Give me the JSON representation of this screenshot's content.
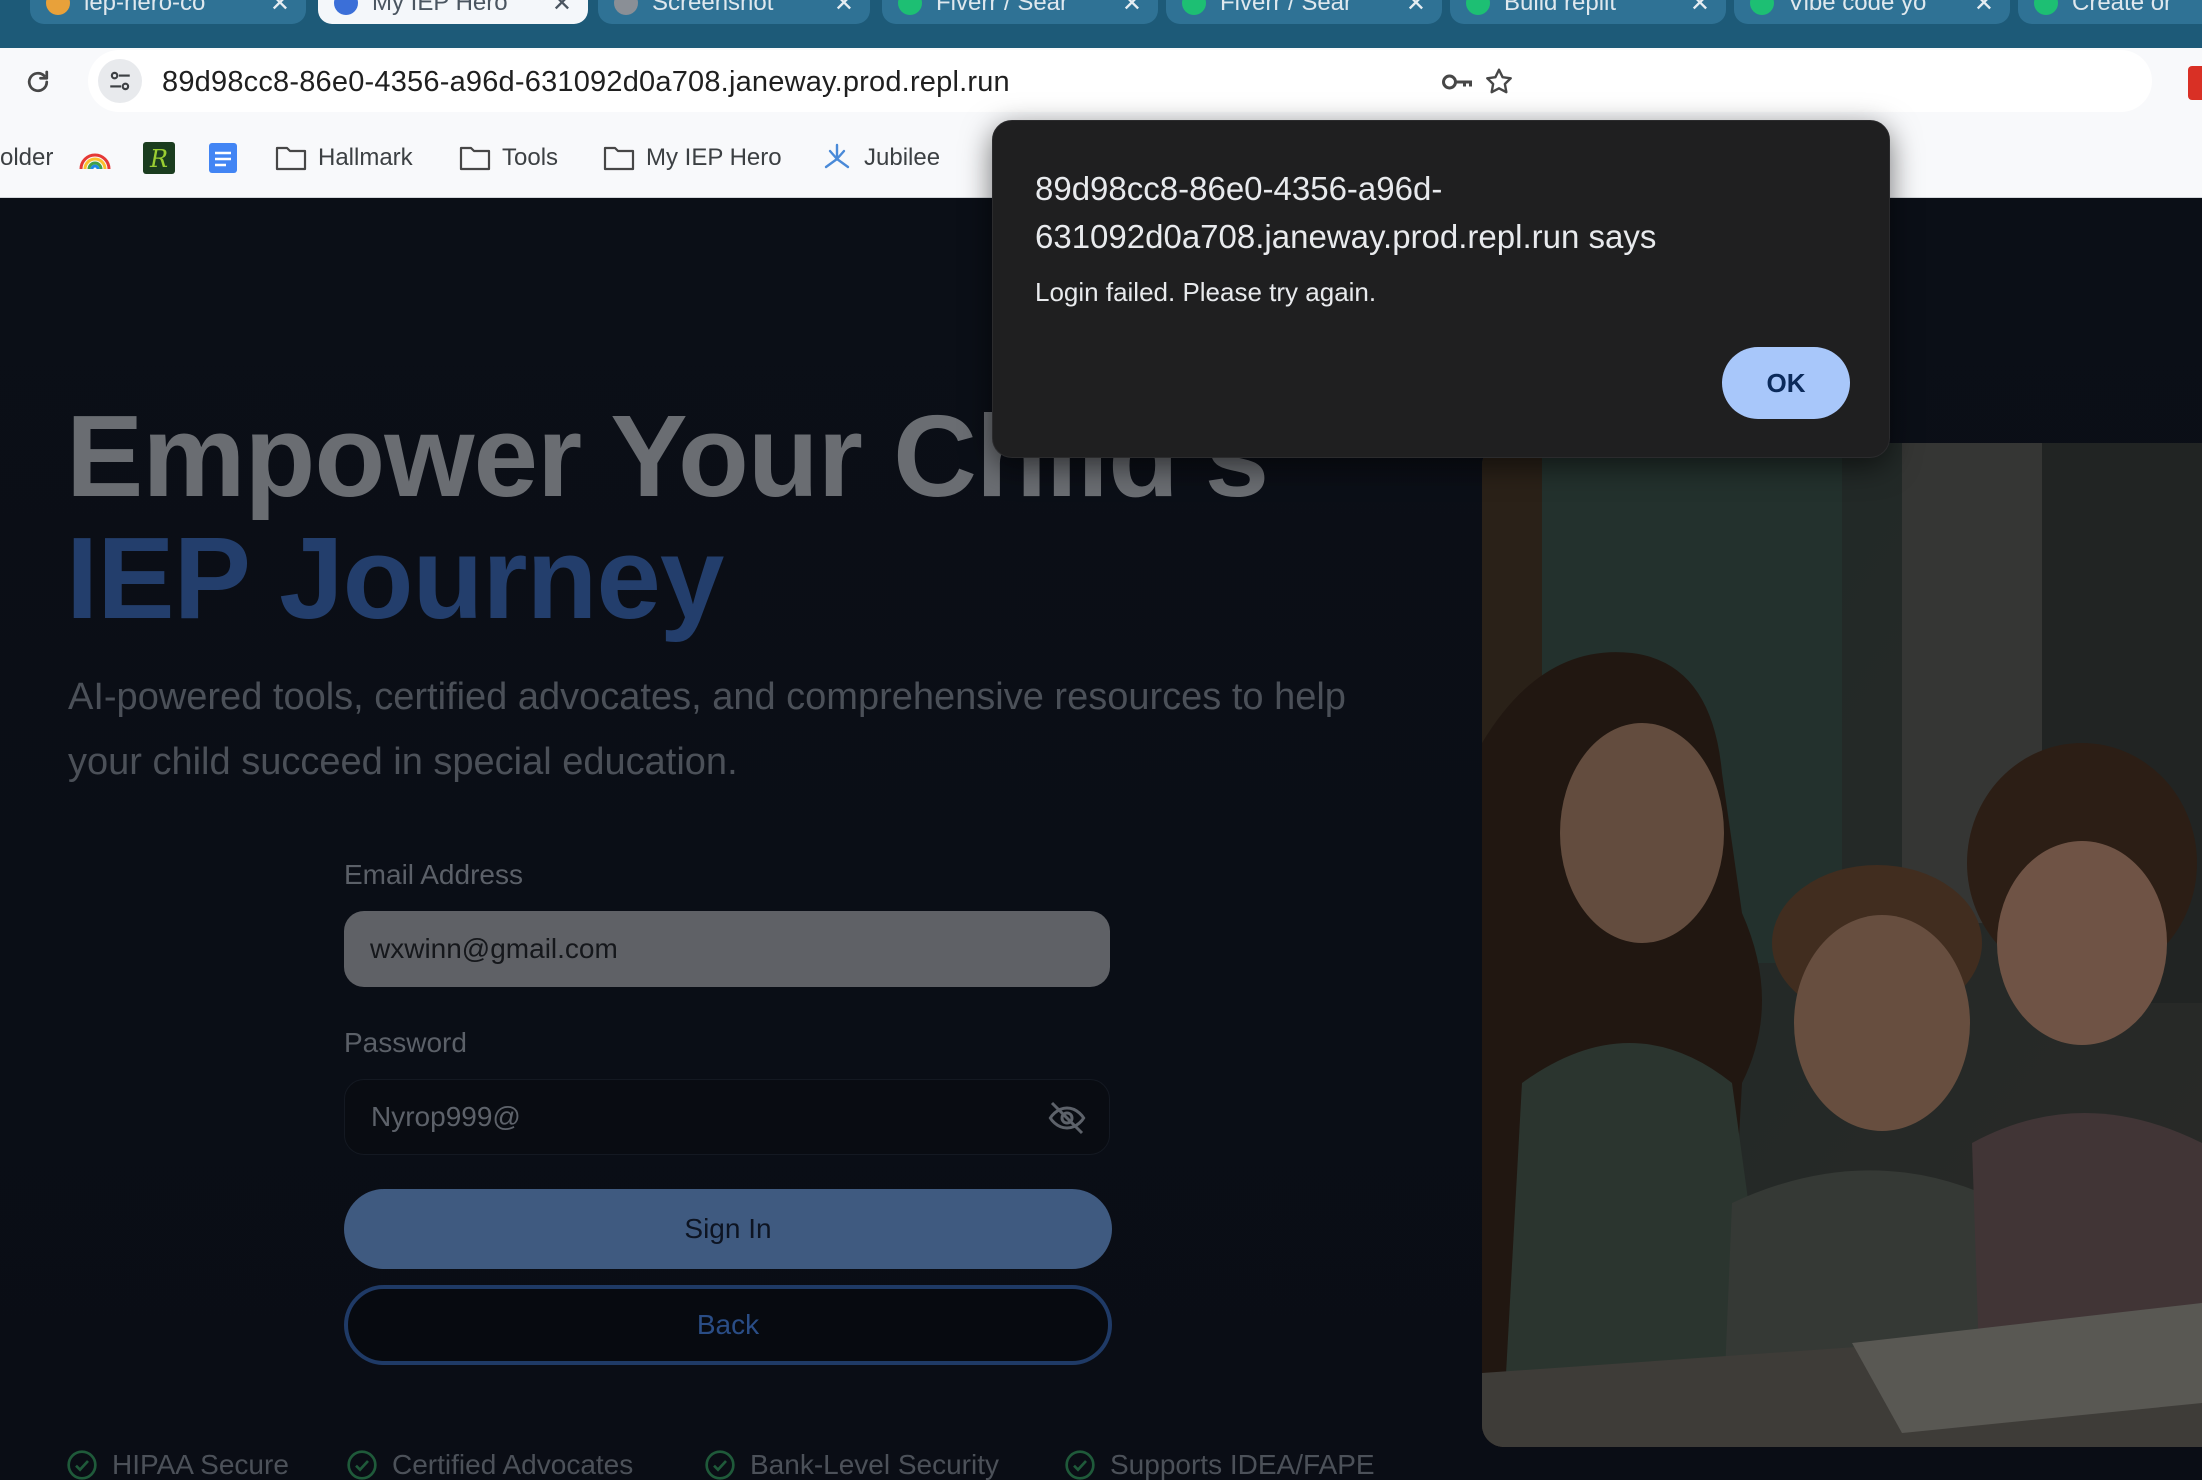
{
  "browser": {
    "tabs": [
      {
        "label": "iep-hero-co",
        "favicon_color": "#e8a13a",
        "active": false
      },
      {
        "label": "My IEP Hero",
        "favicon_color": "#3b6fd8",
        "active": true
      },
      {
        "label": "Screenshot",
        "favicon_color": "#8a8f96",
        "active": false
      },
      {
        "label": "Fiverr / Sear",
        "favicon_color": "#1dbf73",
        "active": false
      },
      {
        "label": "Fiverr / Sear",
        "favicon_color": "#1dbf73",
        "active": false
      },
      {
        "label": "Build replit",
        "favicon_color": "#1dbf73",
        "active": false
      },
      {
        "label": "Vibe code yo",
        "favicon_color": "#1dbf73",
        "active": false
      },
      {
        "label": "Create or",
        "favicon_color": "#1dbf73",
        "active": false
      }
    ],
    "tab_close_glyph": "✕",
    "url": "89d98cc8-86e0-4356-a96d-631092d0a708.janeway.prod.repl.run",
    "bookmarks": [
      {
        "label": "older",
        "icon": "folder-icon"
      },
      {
        "label": "",
        "icon": "rainbow-icon"
      },
      {
        "label": "",
        "icon": "r-logo-icon"
      },
      {
        "label": "",
        "icon": "docs-icon"
      },
      {
        "label": "Hallmark",
        "icon": "folder-icon"
      },
      {
        "label": "Tools",
        "icon": "folder-icon"
      },
      {
        "label": "My IEP Hero",
        "icon": "folder-icon"
      },
      {
        "label": "Jubilee",
        "icon": "jubilee-icon"
      }
    ]
  },
  "hero": {
    "title_line1": "Empower Your Child's",
    "title_line2": "IEP Journey",
    "subtitle": "AI-powered tools, certified advocates, and comprehensive resources to help your child succeed in special education."
  },
  "login": {
    "email_label": "Email Address",
    "email_value": "wxwinn@gmail.com",
    "password_label": "Password",
    "password_value": "Nyrop999@",
    "signin_label": "Sign In",
    "back_label": "Back"
  },
  "trust_badges": [
    "HIPAA Secure",
    "Certified Advocates",
    "Bank-Level Security",
    "Supports IDEA/FAPE"
  ],
  "alert": {
    "origin": "89d98cc8-86e0-4356-a96d-631092d0a708.janeway.prod.repl.run says",
    "message": "Login failed. Please try again.",
    "ok_label": "OK"
  },
  "colors": {
    "tabstrip": "#1d5a78",
    "accent_blue": "#233e6c",
    "alert_bg": "#1f1f20",
    "ok_button": "#a8c7fa"
  }
}
